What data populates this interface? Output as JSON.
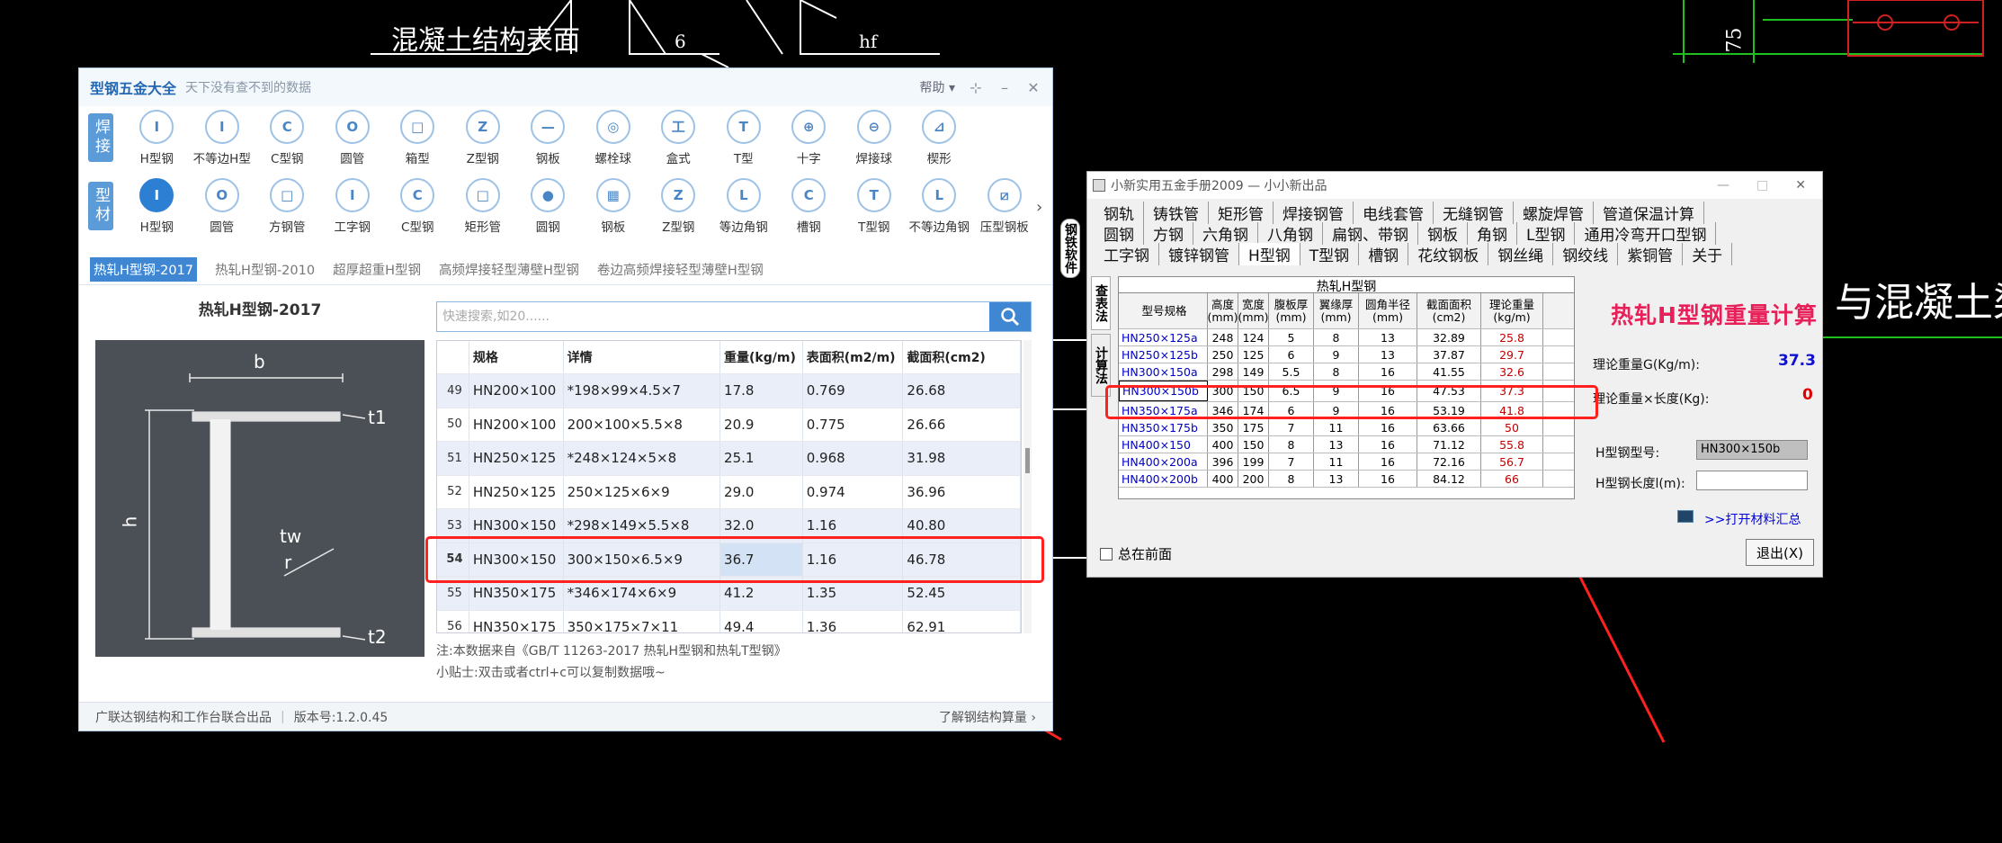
{
  "background": {
    "cad_text_1": "混凝土结构表面",
    "cad_text_2": "6",
    "cad_text_3": "hf",
    "cad_text_4": "75",
    "cad_text_5": "与混凝土梁"
  },
  "steel_app": {
    "title": "型钢五金大全",
    "subtitle": "天下没有查不到的数据",
    "help": "帮助",
    "row1_tag": "焊接",
    "row2_tag": "型材",
    "row1": [
      "H型钢",
      "不等边H型",
      "C型钢",
      "圆管",
      "箱型",
      "Z型钢",
      "钢板",
      "螺栓球",
      "盒式",
      "T型",
      "十字",
      "焊接球",
      "楔形"
    ],
    "row1_glyphs": [
      "I",
      "I",
      "C",
      "O",
      "□",
      "Z",
      "—",
      "◎",
      "工",
      "T",
      "⊕",
      "⊖",
      "⊿"
    ],
    "row2": [
      "H型钢",
      "圆管",
      "方钢管",
      "工字钢",
      "C型钢",
      "矩形管",
      "圆钢",
      "钢板",
      "Z型钢",
      "等边角钢",
      "槽钢",
      "T型钢",
      "不等边角钢",
      "压型钢板"
    ],
    "row2_glyphs": [
      "I",
      "O",
      "□",
      "I",
      "C",
      "□",
      "●",
      "▦",
      "Z",
      "L",
      "C",
      "T",
      "L",
      "⧄"
    ],
    "subtabs": [
      "热轧H型钢-2017",
      "热轧H型钢-2010",
      "超厚超重H型钢",
      "高频焊接轻型薄壁H型钢",
      "卷边高频焊接轻型薄壁H型钢"
    ],
    "panel_title": "热轧H型钢-2017",
    "diagram": {
      "b": "b",
      "h": "h",
      "t1": "t1",
      "t2": "t2",
      "tw": "tw",
      "r": "r"
    },
    "search_placeholder": "快速搜索,如20......",
    "columns": [
      "",
      "规格",
      "详情",
      "重量(kg/m)",
      "表面积(m2/m)",
      "截面积(cm2)"
    ],
    "rows": [
      [
        "49",
        "HN200×100",
        "*198×99×4.5×7",
        "17.8",
        "0.769",
        "26.68"
      ],
      [
        "50",
        "HN200×100",
        "200×100×5.5×8",
        "20.9",
        "0.775",
        "26.66"
      ],
      [
        "51",
        "HN250×125",
        "*248×124×5×8",
        "25.1",
        "0.968",
        "31.98"
      ],
      [
        "52",
        "HN250×125",
        "250×125×6×9",
        "29.0",
        "0.974",
        "36.96"
      ],
      [
        "53",
        "HN300×150",
        "*298×149×5.5×8",
        "32.0",
        "1.16",
        "40.80"
      ],
      [
        "54",
        "HN300×150",
        "300×150×6.5×9",
        "36.7",
        "1.16",
        "46.78"
      ],
      [
        "55",
        "HN350×175",
        "*346×174×6×9",
        "41.2",
        "1.35",
        "52.45"
      ],
      [
        "56",
        "HN350×175",
        "350×175×7×11",
        "49.4",
        "1.36",
        "62.91"
      ]
    ],
    "note": "注:本数据来自《GB/T 11263-2017 热轧H型钢和热轧T型钢》",
    "tip": "小贴士:双击或者ctrl+c可以复制数据哦~",
    "footer_left": "广联达钢结构和工作台联合出品",
    "footer_version": "版本号:1.2.0.45",
    "footer_right": "了解钢结构算量"
  },
  "hardware_app": {
    "title": "小新实用五金手册2009 — 小小新出品",
    "menu_rows": [
      [
        "钢轨",
        "铸铁管",
        "矩形管",
        "焊接钢管",
        "电线套管",
        "无缝钢管",
        "螺旋焊管",
        "管道保温计算"
      ],
      [
        "圆钢",
        "方钢",
        "六角钢",
        "八角钢",
        "扁钢、带钢",
        "钢板",
        "角钢",
        "L型钢",
        "通用冷弯开口型钢"
      ],
      [
        "工字钢",
        "镀锌钢管",
        "H型钢",
        "T型钢",
        "槽钢",
        "花纹钢板",
        "钢丝绳",
        "钢绞线",
        "紫铜管",
        "关于"
      ]
    ],
    "vtab1": "钢铁软件",
    "vtab2": "查表法",
    "vtab3": "计算法",
    "table_caption": "热轧H型钢",
    "columns": [
      "型号规格",
      "高度(mm)",
      "宽度(mm)",
      "腹板厚(mm)",
      "翼缘厚(mm)",
      "圆角半径(mm)",
      "截面面积(cm2)",
      "理论重量(kg/m)"
    ],
    "rows": [
      [
        "HN250×125a",
        "248",
        "124",
        "5",
        "8",
        "13",
        "32.89",
        "25.8"
      ],
      [
        "HN250×125b",
        "250",
        "125",
        "6",
        "9",
        "13",
        "37.87",
        "29.7"
      ],
      [
        "HN300×150a",
        "298",
        "149",
        "5.5",
        "8",
        "16",
        "41.55",
        "32.6"
      ],
      [
        "HN300×150b",
        "300",
        "150",
        "6.5",
        "9",
        "16",
        "47.53",
        "37.3"
      ],
      [
        "HN350×175a",
        "346",
        "174",
        "6",
        "9",
        "16",
        "53.19",
        "41.8"
      ],
      [
        "HN350×175b",
        "350",
        "175",
        "7",
        "11",
        "16",
        "63.66",
        "50"
      ],
      [
        "HN400×150",
        "400",
        "150",
        "8",
        "13",
        "16",
        "71.12",
        "55.8"
      ],
      [
        "HN400×200a",
        "396",
        "199",
        "7",
        "11",
        "16",
        "72.16",
        "56.7"
      ],
      [
        "HN400×200b",
        "400",
        "200",
        "8",
        "13",
        "16",
        "84.12",
        "66"
      ]
    ],
    "calc_title": "热轧H型钢重量计算",
    "weight_label": "理论重量G(Kg/m):",
    "weight_value": "37.3",
    "total_label": "理论重量×长度(Kg):",
    "total_value": "0",
    "model_label": "H型钢型号:",
    "model_value": "HN300×150b",
    "length_label": "H型钢长度l(m):",
    "length_value": "",
    "link": ">>打开材料汇总",
    "ontop": "总在前面",
    "exit": "退出(X)"
  },
  "colors": {
    "accent": "#2d7fd4",
    "red": "#ff2020",
    "pink": "#e8205a"
  }
}
